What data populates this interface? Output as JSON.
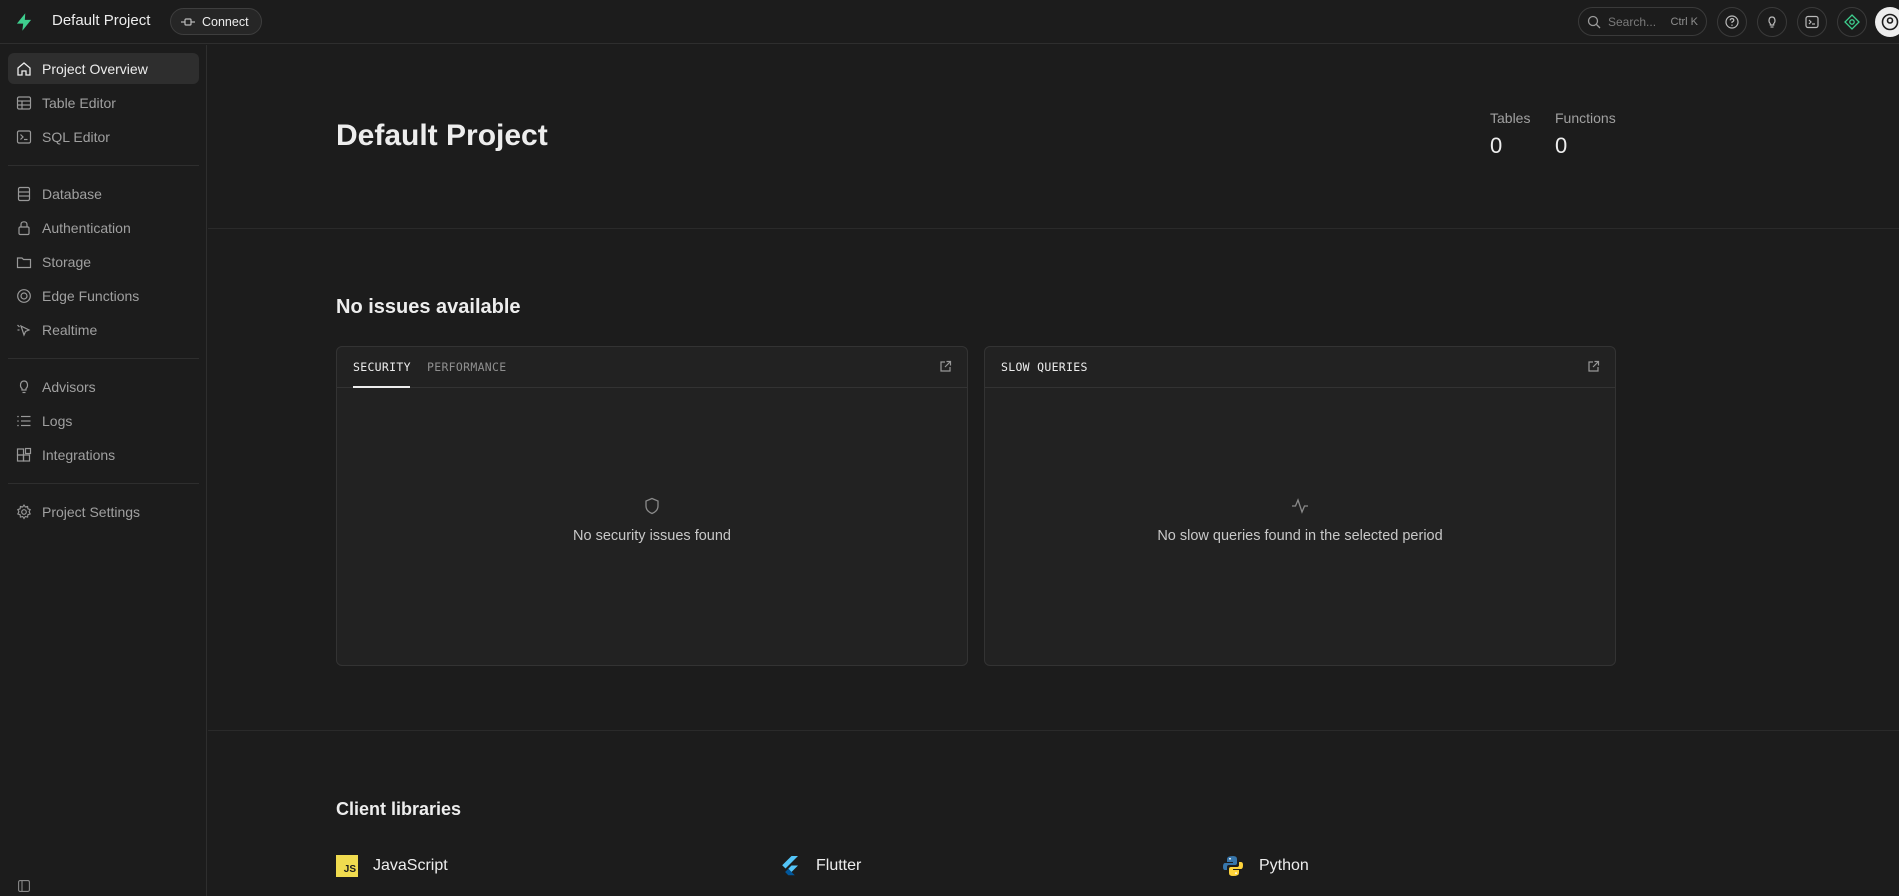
{
  "header": {
    "project_name": "Default Project",
    "connect_label": "Connect",
    "search_placeholder": "Search...",
    "search_shortcut": "Ctrl K",
    "brand_color": "#3ecf8e"
  },
  "sidebar": {
    "items": [
      {
        "label": "Project Overview",
        "icon": "home-icon",
        "active": true
      },
      {
        "label": "Table Editor",
        "icon": "table-icon"
      },
      {
        "label": "SQL Editor",
        "icon": "terminal-icon"
      },
      {
        "label": "Database",
        "icon": "database-icon"
      },
      {
        "label": "Authentication",
        "icon": "lock-icon"
      },
      {
        "label": "Storage",
        "icon": "archive-icon"
      },
      {
        "label": "Edge Functions",
        "icon": "globe-icon"
      },
      {
        "label": "Realtime",
        "icon": "pointer-icon"
      },
      {
        "label": "Advisors",
        "icon": "lightbulb-icon"
      },
      {
        "label": "Logs",
        "icon": "list-icon"
      },
      {
        "label": "Integrations",
        "icon": "blocks-icon"
      },
      {
        "label": "Project Settings",
        "icon": "gear-icon"
      }
    ]
  },
  "main": {
    "title": "Default Project",
    "stats": [
      {
        "label": "Tables",
        "value": "0"
      },
      {
        "label": "Functions",
        "value": "0"
      }
    ],
    "issues_title": "No issues available",
    "security_panel": {
      "tabs": [
        "SECURITY",
        "PERFORMANCE"
      ],
      "empty_message": "No security issues found"
    },
    "slow_panel": {
      "title": "SLOW QUERIES",
      "empty_message": "No slow queries found in the selected period"
    },
    "libraries_title": "Client libraries",
    "libraries": [
      {
        "name": "JavaScript",
        "badge": "JS"
      },
      {
        "name": "Flutter"
      },
      {
        "name": "Python"
      }
    ]
  }
}
